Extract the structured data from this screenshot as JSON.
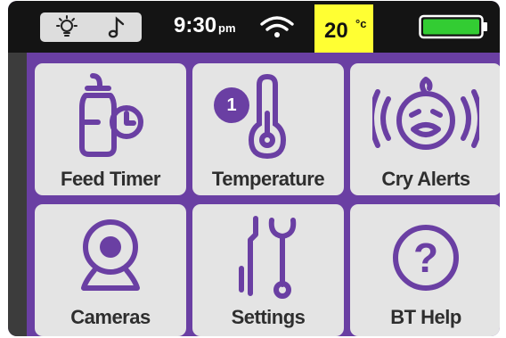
{
  "status_bar": {
    "icons": [
      "light-bulb-icon",
      "music-note-icon",
      "wifi-icon",
      "battery-icon"
    ],
    "time": "9:30",
    "time_suffix": "pm",
    "temperature_value": "20",
    "temperature_unit": "°c",
    "battery_level": 1.0
  },
  "menu": {
    "tiles": [
      {
        "label": "Feed Timer",
        "icon": "bottle-timer-icon"
      },
      {
        "label": "Temperature",
        "icon": "thermometer-icon"
      },
      {
        "label": "Cry Alerts",
        "icon": "crying-baby-icon"
      },
      {
        "label": "Cameras",
        "icon": "camera-icon"
      },
      {
        "label": "Settings",
        "icon": "tools-icon"
      },
      {
        "label": "BT Help",
        "icon": "help-icon"
      }
    ]
  },
  "callout": {
    "number": "1"
  },
  "colors": {
    "accent": "#6a3fa3",
    "tile_bg": "#e4e4e4",
    "status_bar_bg": "#141414",
    "temperature_highlight": "#ffff33",
    "battery_fill": "#33cc33"
  }
}
